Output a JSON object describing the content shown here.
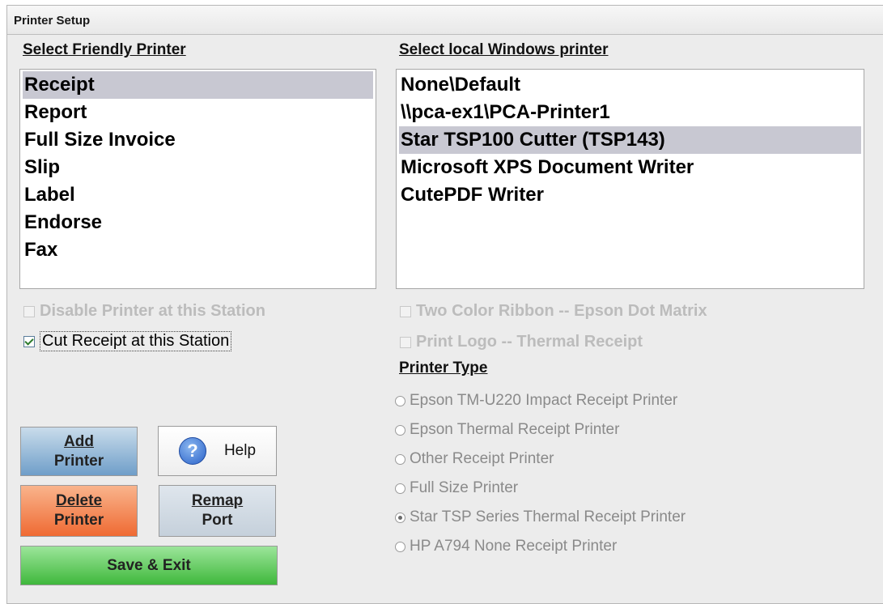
{
  "window": {
    "title": "Printer Setup"
  },
  "friendly_printers": {
    "header": "Select Friendly Printer",
    "items": [
      "Receipt",
      "Report",
      "Full Size Invoice",
      "Slip",
      "Label",
      "Endorse",
      "Fax"
    ],
    "selected_index": 0
  },
  "windows_printers": {
    "header": "Select local Windows printer",
    "items": [
      "None\\Default",
      "\\\\pca-ex1\\PCA-Printer1",
      "Star TSP100 Cutter (TSP143)",
      "Microsoft XPS Document Writer",
      "CutePDF Writer"
    ],
    "selected_index": 2
  },
  "checkboxes": {
    "disable_printer": {
      "label": "Disable Printer at this Station",
      "checked": false,
      "enabled": false
    },
    "cut_receipt": {
      "label": "Cut Receipt at this Station",
      "checked": true,
      "enabled": true
    },
    "two_color_ribbon": {
      "label": "Two Color Ribbon -- Epson Dot Matrix",
      "checked": false,
      "enabled": false
    },
    "print_logo": {
      "label": "Print Logo -- Thermal Receipt",
      "checked": false,
      "enabled": false
    }
  },
  "printer_type": {
    "header": "Printer Type",
    "options": [
      "Epson TM-U220 Impact Receipt Printer",
      "Epson Thermal Receipt Printer",
      "Other Receipt Printer",
      "Full Size Printer",
      "Star TSP Series Thermal Receipt Printer",
      "HP A794 None Receipt Printer"
    ],
    "selected_index": 4
  },
  "buttons": {
    "add_line1": "Add",
    "add_line2": "Printer",
    "help": "Help",
    "delete_line1": "Delete",
    "delete_line2": "Printer",
    "remap_line1": "Remap",
    "remap_line2": "Port",
    "save_exit": "Save & Exit"
  },
  "icons": {
    "help": "help-question-icon"
  }
}
